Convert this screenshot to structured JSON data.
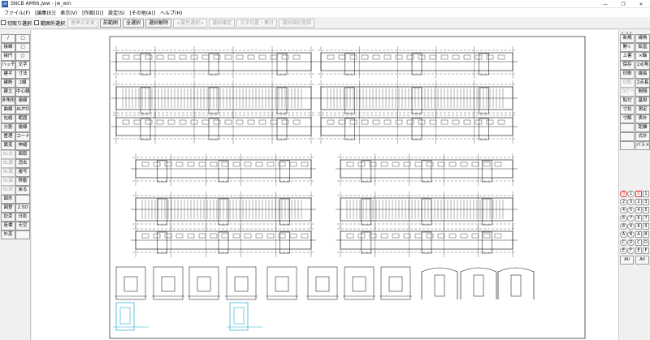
{
  "window": {
    "title": "SNCB AM66.jww - jw_win",
    "logo": "JW",
    "controls": [
      "—",
      "❐",
      "✕"
    ]
  },
  "menu": [
    "ファイル(F)",
    "[編集(E)]",
    "表示(V)",
    "[作図(D)]",
    "設定(S)",
    "[その他(A)]",
    "ヘルプ(H)"
  ],
  "toolbar": {
    "checks": [
      "切取り選択",
      "範囲外選択"
    ],
    "buttons": [
      {
        "label": "基準点変更",
        "enabled": false
      },
      {
        "label": "前範囲",
        "enabled": true
      },
      {
        "label": "全選択",
        "enabled": true
      },
      {
        "label": "選択解除",
        "enabled": true
      },
      {
        "label": "<属性選択>",
        "enabled": false
      },
      {
        "label": "選択確定",
        "enabled": false
      },
      {
        "label": "文字位置・集計",
        "enabled": false
      },
      {
        "label": "選択図形登録",
        "enabled": false
      }
    ]
  },
  "left_tools": [
    {
      "label": "/",
      "enabled": true
    },
    {
      "label": "□",
      "enabled": true
    },
    {
      "label": "接線",
      "enabled": true
    },
    {
      "label": "□",
      "enabled": true
    },
    {
      "label": "接円",
      "enabled": true
    },
    {
      "label": "○",
      "enabled": true
    },
    {
      "label": "ハッチ",
      "enabled": true
    },
    {
      "label": "文字",
      "enabled": true
    },
    {
      "label": "建平",
      "enabled": true
    },
    {
      "label": "寸法",
      "enabled": true
    },
    {
      "label": "建断",
      "enabled": true
    },
    {
      "label": "2線",
      "enabled": true
    },
    {
      "label": "建立",
      "enabled": true
    },
    {
      "label": "中心線",
      "enabled": true
    },
    {
      "label": "多角形",
      "enabled": true
    },
    {
      "label": "連線",
      "enabled": true
    },
    {
      "label": "曲線",
      "enabled": true
    },
    {
      "label": "AUTO",
      "enabled": true
    },
    {
      "label": "包絡",
      "enabled": true
    },
    {
      "label": "範囲",
      "enabled": true
    },
    {
      "label": "分割",
      "enabled": true
    },
    {
      "label": "複線",
      "enabled": true
    },
    {
      "label": "整理",
      "enabled": true
    },
    {
      "label": "コーナー",
      "enabled": true
    },
    {
      "label": "属変",
      "enabled": true
    },
    {
      "label": "伸縮",
      "enabled": true
    },
    {
      "label": "BL化",
      "enabled": false
    },
    {
      "label": "面取",
      "enabled": true
    },
    {
      "label": "BL解",
      "enabled": false
    },
    {
      "label": "消去",
      "enabled": true
    },
    {
      "label": "BL属",
      "enabled": false
    },
    {
      "label": "複写",
      "enabled": true
    },
    {
      "label": "BL編",
      "enabled": false
    },
    {
      "label": "移動",
      "enabled": true
    },
    {
      "label": "BL終",
      "enabled": false
    },
    {
      "label": "戻る",
      "enabled": true
    },
    {
      "label": "図形",
      "enabled": true
    },
    {
      "label": "",
      "enabled": true
    },
    {
      "label": "図登",
      "enabled": true
    },
    {
      "label": "2.5D",
      "enabled": true
    },
    {
      "label": "記変",
      "enabled": true
    },
    {
      "label": "日影",
      "enabled": true
    },
    {
      "label": "座標",
      "enabled": true
    },
    {
      "label": "天空",
      "enabled": true
    },
    {
      "label": "外変",
      "enabled": true
    },
    {
      "label": "",
      "enabled": true
    }
  ],
  "right_tools": [
    {
      "label": "新規",
      "enabled": true
    },
    {
      "label": "線角",
      "enabled": true
    },
    {
      "label": "開く",
      "enabled": true
    },
    {
      "label": "鉛直",
      "enabled": true
    },
    {
      "label": "上書",
      "enabled": true
    },
    {
      "label": "×軸",
      "enabled": true
    },
    {
      "label": "保存",
      "enabled": true
    },
    {
      "label": "2点角",
      "enabled": true
    },
    {
      "label": "印刷",
      "enabled": true
    },
    {
      "label": "線長",
      "enabled": true
    },
    {
      "label": "切取",
      "enabled": false
    },
    {
      "label": "2点長",
      "enabled": true
    },
    {
      "label": "コピー",
      "enabled": false
    },
    {
      "label": "間隔",
      "enabled": true
    },
    {
      "label": "貼付",
      "enabled": true
    },
    {
      "label": "基設",
      "enabled": true
    },
    {
      "label": "寸化",
      "enabled": true
    },
    {
      "label": "測定",
      "enabled": true
    },
    {
      "label": "寸解",
      "enabled": true
    },
    {
      "label": "表計",
      "enabled": true
    },
    {
      "label": "",
      "enabled": true
    },
    {
      "label": "距離",
      "enabled": true
    },
    {
      "label": "",
      "enabled": true
    },
    {
      "label": "式計",
      "enabled": true
    },
    {
      "label": "",
      "enabled": true
    },
    {
      "label": "パラメ",
      "enabled": true
    }
  ],
  "layer_groups": [
    "0",
    "1",
    "2",
    "3",
    "4",
    "5",
    "6",
    "7",
    "8",
    "9",
    "A",
    "B",
    "C",
    "D",
    "E",
    "F"
  ],
  "layers": [
    "0",
    "1",
    "2",
    "3",
    "4",
    "5",
    "6",
    "7",
    "8",
    "9",
    "A",
    "B",
    "C",
    "D",
    "E",
    "F"
  ],
  "layer_all_label": "All",
  "accent_colors": {
    "current_layer": "#dd3333",
    "guide_line": "#22aacc",
    "drawing_line": "#000000"
  }
}
